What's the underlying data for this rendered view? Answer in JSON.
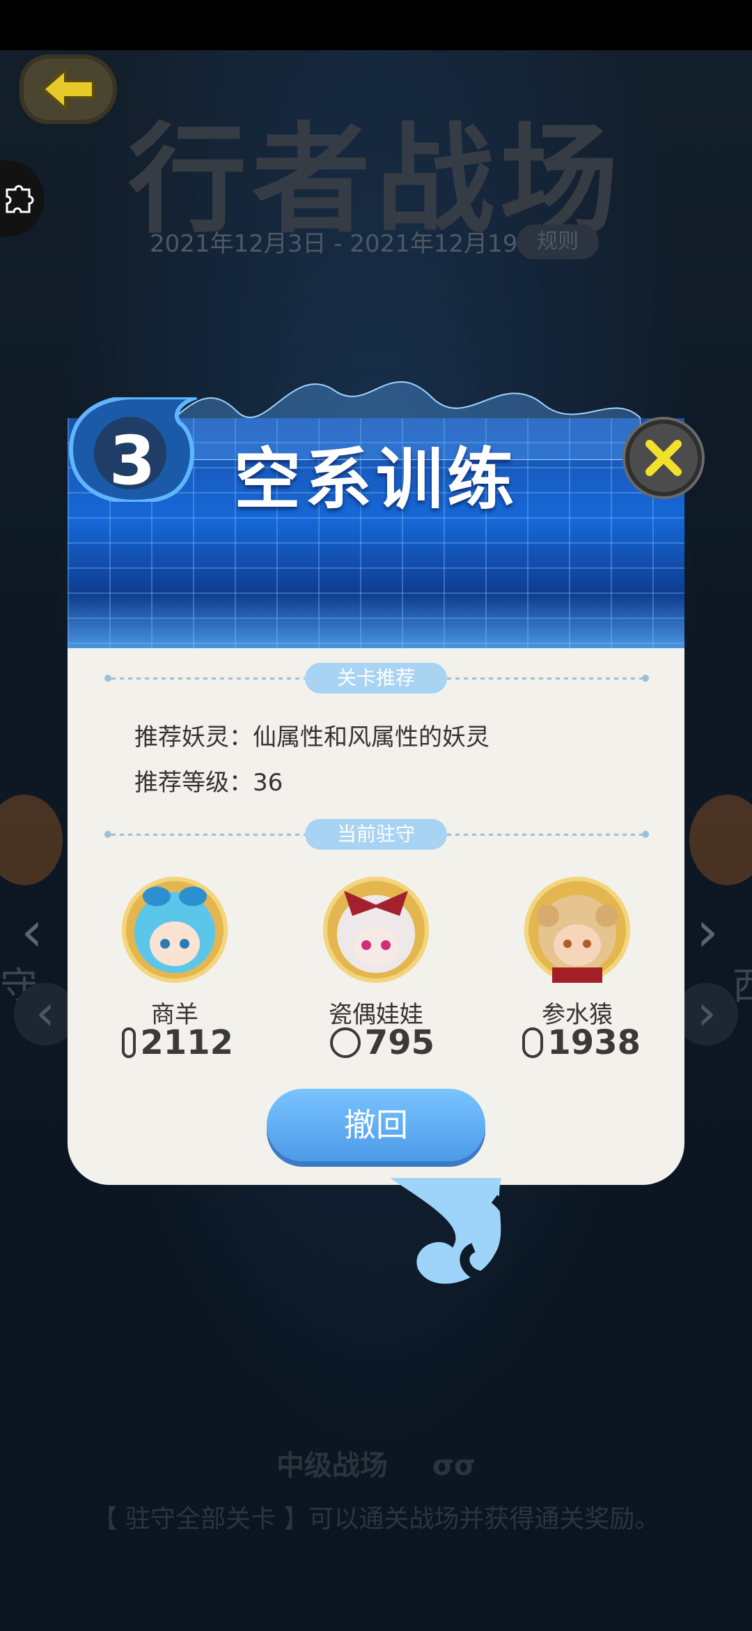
{
  "colors": {
    "accent_blue": "#4d9be8",
    "panel_bg": "#f3f1ec",
    "close_yellow": "#f2e12a",
    "back_yellow": "#e8c92a"
  },
  "background": {
    "title": "行者战场",
    "date_range": "2021年12月3日 - 2021年12月19日",
    "rules_label": "规则",
    "bottom_title": "中级战场",
    "bottom_tip": "【 驻守全部关卡 】可以通关战场并获得通关奖励。",
    "side_text_left": "守",
    "side_text_right": "西"
  },
  "modal": {
    "level_number": "3",
    "title": "空系训练",
    "recommend_section": "关卡推荐",
    "recommend_spirit": "推荐妖灵：仙属性和风属性的妖灵",
    "recommend_level": "推荐等级：36",
    "guard_section": "当前驻守",
    "guards": [
      {
        "name": "商羊",
        "power": "2112",
        "avatar_icon": "girl-blue-hair-avatar-icon"
      },
      {
        "name": "瓷偶娃娃",
        "power": "795",
        "avatar_icon": "doll-red-bow-avatar-icon"
      },
      {
        "name": "参水猿",
        "power": "1938",
        "avatar_icon": "monkey-girl-avatar-icon"
      }
    ],
    "retract_label": "撤回"
  }
}
